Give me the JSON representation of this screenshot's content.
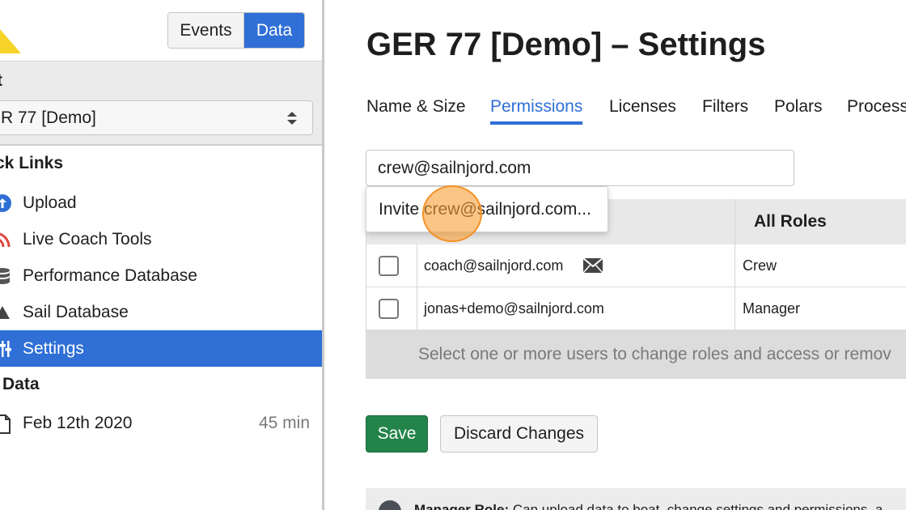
{
  "sidebar": {
    "view_toggle": {
      "events_label": "Events",
      "data_label": "Data",
      "selected": "Data"
    },
    "boat": {
      "section_label": "t",
      "selected_value": "R 77 [Demo]"
    },
    "quick_links": {
      "title": "ck Links",
      "items": [
        {
          "label": "Upload",
          "icon": "upload-icon"
        },
        {
          "label": "Live Coach Tools",
          "icon": "broadcast-icon"
        },
        {
          "label": "Performance Database",
          "icon": "database-icon"
        },
        {
          "label": "Sail Database",
          "icon": "sail-icon"
        },
        {
          "label": "Settings",
          "icon": "sliders-icon",
          "active": true
        }
      ]
    },
    "data_section": {
      "title": "Data",
      "files": [
        {
          "name": "Feb 12th 2020",
          "duration": "45 min"
        }
      ]
    }
  },
  "main": {
    "title": "GER 77 [Demo] – Settings",
    "tabs": [
      {
        "label": "Name & Size"
      },
      {
        "label": "Permissions",
        "active": true
      },
      {
        "label": "Licenses"
      },
      {
        "label": "Filters"
      },
      {
        "label": "Polars"
      },
      {
        "label": "Process"
      }
    ],
    "invite_input": {
      "value": "crew@sailnjord.com"
    },
    "autocomplete": {
      "prefix": "Invite ",
      "text": "crew@sailnjord.com..."
    },
    "users_table": {
      "roles_header": "All Roles",
      "rows": [
        {
          "email": "coach@sailnjord.com",
          "role": "Crew",
          "pending_invite": true
        },
        {
          "email": "jonas+demo@sailnjord.com",
          "role": "Manager",
          "pending_invite": false
        }
      ],
      "footer_hint": "Select one or more users to change roles and access or remov"
    },
    "buttons": {
      "save": "Save",
      "discard": "Discard Changes"
    },
    "info": {
      "role_label": "Manager Role:",
      "text": "Can upload data to boat, change settings and permissions, a"
    }
  },
  "colors": {
    "accent": "#2f6fd6",
    "save_green": "#23844a",
    "cursor_orange": "#f39226"
  }
}
